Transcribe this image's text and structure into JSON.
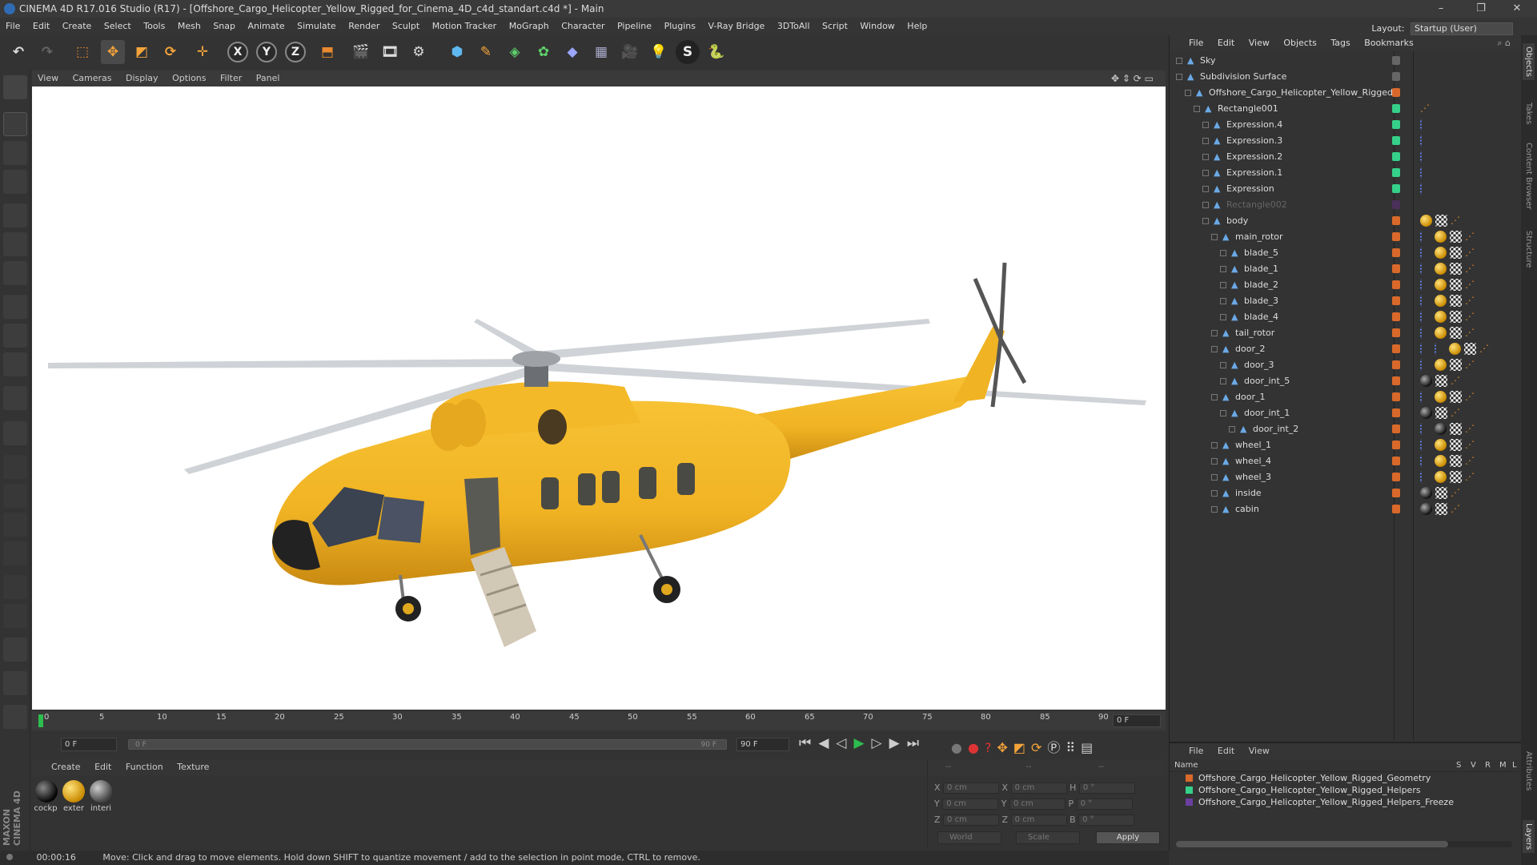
{
  "window": {
    "title": "CINEMA 4D R17.016 Studio (R17) - [Offshore_Cargo_Helicopter_Yellow_Rigged_for_Cinema_4D_c4d_standart.c4d *] - Main",
    "minimize": "–",
    "maximize": "❐",
    "close": "✕"
  },
  "menu": [
    "File",
    "Edit",
    "Create",
    "Select",
    "Tools",
    "Mesh",
    "Snap",
    "Animate",
    "Simulate",
    "Render",
    "Sculpt",
    "Motion Tracker",
    "MoGraph",
    "Character",
    "Pipeline",
    "Plugins",
    "V-Ray Bridge",
    "3DToAll",
    "Script",
    "Window",
    "Help"
  ],
  "layout": {
    "label": "Layout:",
    "value": "Startup (User)"
  },
  "toolbar": {
    "axis_x": "X",
    "axis_y": "Y",
    "axis_z": "Z"
  },
  "viewport": {
    "menu": [
      "View",
      "Cameras",
      "Display",
      "Options",
      "Filter",
      "Panel"
    ]
  },
  "timeline": {
    "ticks": [
      "0",
      "5",
      "10",
      "15",
      "20",
      "25",
      "30",
      "35",
      "40",
      "45",
      "50",
      "55",
      "60",
      "65",
      "70",
      "75",
      "80",
      "85",
      "90"
    ],
    "current_frame": "0 F",
    "start_field": "0 F",
    "range_start": "0 F",
    "range_end": "90 F",
    "end_field": "90 F"
  },
  "materials": {
    "menu": [
      "Create",
      "Edit",
      "Function",
      "Texture"
    ],
    "items": [
      {
        "label": "cockp",
        "kind": "dark"
      },
      {
        "label": "exter",
        "kind": "yellow"
      },
      {
        "label": "interi",
        "kind": "grey"
      }
    ]
  },
  "coords": {
    "header": [
      "--",
      "--",
      "--"
    ],
    "rows": [
      {
        "a": "X",
        "av": "0 cm",
        "b": "X",
        "bv": "0 cm",
        "c": "H",
        "cv": "0 °"
      },
      {
        "a": "Y",
        "av": "0 cm",
        "b": "Y",
        "bv": "0 cm",
        "c": "P",
        "cv": "0 °"
      },
      {
        "a": "Z",
        "av": "0 cm",
        "b": "Z",
        "bv": "0 cm",
        "c": "B",
        "cv": "0 °"
      }
    ],
    "world": "World",
    "scale": "Scale",
    "apply": "Apply"
  },
  "status": {
    "time": "00:00:16",
    "message": "Move: Click and drag to move elements. Hold down SHIFT to quantize movement / add to the selection in point mode, CTRL to remove."
  },
  "object_manager": {
    "menu": [
      "File",
      "Edit",
      "View",
      "Objects",
      "Tags",
      "Bookmarks"
    ],
    "rows": [
      {
        "name": "Sky",
        "depth": 0,
        "dot": "#666",
        "tags": []
      },
      {
        "name": "Subdivision Surface",
        "depth": 0,
        "dot": "#666",
        "tags": []
      },
      {
        "name": "Offshore_Cargo_Helicopter_Yellow_Rigged",
        "depth": 1,
        "dot": "#d9692a",
        "tags": []
      },
      {
        "name": "Rectangle001",
        "depth": 2,
        "dot": "#35d08a",
        "tags": [
          "ik"
        ]
      },
      {
        "name": "Expression.4",
        "depth": 3,
        "dot": "#35d08a",
        "tags": [
          "exp"
        ]
      },
      {
        "name": "Expression.3",
        "depth": 3,
        "dot": "#35d08a",
        "tags": [
          "exp"
        ]
      },
      {
        "name": "Expression.2",
        "depth": 3,
        "dot": "#35d08a",
        "tags": [
          "exp"
        ]
      },
      {
        "name": "Expression.1",
        "depth": 3,
        "dot": "#35d08a",
        "tags": [
          "exp"
        ]
      },
      {
        "name": "Expression",
        "depth": 3,
        "dot": "#35d08a",
        "tags": [
          "exp"
        ]
      },
      {
        "name": "Rectangle002",
        "depth": 3,
        "dot": "#4a2f5a",
        "tags": [],
        "dim": true
      },
      {
        "name": "body",
        "depth": 3,
        "dot": "#d9692a",
        "tags": [
          "mat",
          "chk",
          "ik"
        ]
      },
      {
        "name": "main_rotor",
        "depth": 4,
        "dot": "#d9692a",
        "tags": [
          "exp",
          "mat",
          "chk",
          "ik"
        ]
      },
      {
        "name": "blade_5",
        "depth": 5,
        "dot": "#d9692a",
        "tags": [
          "exp",
          "mat",
          "chk",
          "ik"
        ]
      },
      {
        "name": "blade_1",
        "depth": 5,
        "dot": "#d9692a",
        "tags": [
          "exp",
          "mat",
          "chk",
          "ik"
        ]
      },
      {
        "name": "blade_2",
        "depth": 5,
        "dot": "#d9692a",
        "tags": [
          "exp",
          "mat",
          "chk",
          "ik"
        ]
      },
      {
        "name": "blade_3",
        "depth": 5,
        "dot": "#d9692a",
        "tags": [
          "exp",
          "mat",
          "chk",
          "ik"
        ]
      },
      {
        "name": "blade_4",
        "depth": 5,
        "dot": "#d9692a",
        "tags": [
          "exp",
          "mat",
          "chk",
          "ik"
        ]
      },
      {
        "name": "tail_rotor",
        "depth": 4,
        "dot": "#d9692a",
        "tags": [
          "exp",
          "mat",
          "chk",
          "ik"
        ]
      },
      {
        "name": "door_2",
        "depth": 4,
        "dot": "#d9692a",
        "tags": [
          "exp",
          "exp",
          "mat",
          "chk",
          "ik"
        ]
      },
      {
        "name": "door_3",
        "depth": 5,
        "dot": "#d9692a",
        "tags": [
          "exp",
          "mat",
          "chk",
          "ik"
        ]
      },
      {
        "name": "door_int_5",
        "depth": 5,
        "dot": "#d9692a",
        "tags": [
          "dark",
          "chk",
          "ik"
        ]
      },
      {
        "name": "door_1",
        "depth": 4,
        "dot": "#d9692a",
        "tags": [
          "exp",
          "mat",
          "chk",
          "ik"
        ]
      },
      {
        "name": "door_int_1",
        "depth": 5,
        "dot": "#d9692a",
        "tags": [
          "dark",
          "chk",
          "ik"
        ]
      },
      {
        "name": "door_int_2",
        "depth": 6,
        "dot": "#d9692a",
        "tags": [
          "exp",
          "dark",
          "chk",
          "ik"
        ]
      },
      {
        "name": "wheel_1",
        "depth": 4,
        "dot": "#d9692a",
        "tags": [
          "exp",
          "mat",
          "chk",
          "ik"
        ]
      },
      {
        "name": "wheel_4",
        "depth": 4,
        "dot": "#d9692a",
        "tags": [
          "exp",
          "mat",
          "chk",
          "ik"
        ]
      },
      {
        "name": "wheel_3",
        "depth": 4,
        "dot": "#d9692a",
        "tags": [
          "exp",
          "mat",
          "chk",
          "ik"
        ]
      },
      {
        "name": "inside",
        "depth": 4,
        "dot": "#d9692a",
        "tags": [
          "dark",
          "chk",
          "ik"
        ]
      },
      {
        "name": "cabin",
        "depth": 4,
        "dot": "#d9692a",
        "tags": [
          "dark",
          "chk",
          "ik"
        ]
      }
    ]
  },
  "layers": {
    "menu": [
      "File",
      "Edit",
      "View"
    ],
    "columns": [
      "Name",
      "S",
      "V",
      "R",
      "M",
      "L"
    ],
    "rows": [
      {
        "name": "Offshore_Cargo_Helicopter_Yellow_Rigged_Geometry",
        "color": "#d9692a"
      },
      {
        "name": "Offshore_Cargo_Helicopter_Yellow_Rigged_Helpers",
        "color": "#35d08a"
      },
      {
        "name": "Offshore_Cargo_Helicopter_Yellow_Rigged_Helpers_Freeze",
        "color": "#6a3fa0"
      }
    ]
  },
  "side_tabs": [
    "Objects",
    "Takes",
    "Content Browser",
    "Structure",
    "Attributes",
    "Layers"
  ],
  "brand": "MAXON CINEMA 4D"
}
